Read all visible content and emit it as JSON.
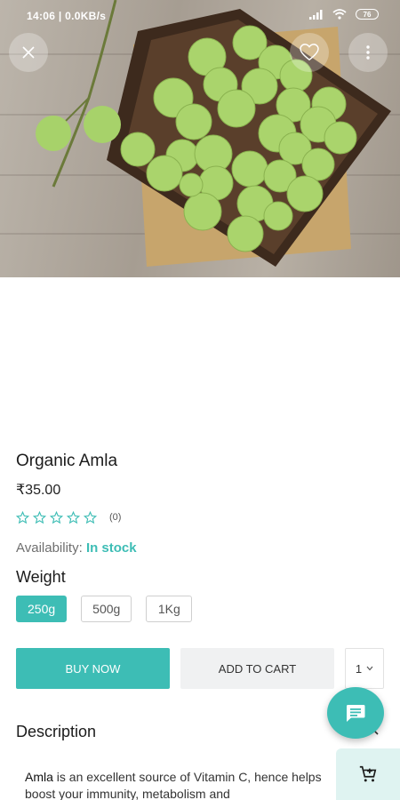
{
  "status_bar": {
    "time": "14:06 | 0.0KB/s",
    "battery": "76"
  },
  "product": {
    "name": "Organic Amla",
    "price": "₹35.00",
    "rating_value": 0,
    "review_count": "(0)",
    "availability_label": "Availability:",
    "availability_value": "In stock"
  },
  "weight": {
    "title": "Weight",
    "options": [
      "250g",
      "500g",
      "1Kg"
    ],
    "selected": "250g"
  },
  "actions": {
    "buy_now": "BUY NOW",
    "add_to_cart": "ADD TO CART",
    "quantity": "1"
  },
  "description": {
    "title": "Description",
    "highlight": "Amla",
    "text_rest": " is an excellent source of Vitamin C, hence helps boost your immunity, metabolism and"
  },
  "icons": {
    "close": "close-icon",
    "favorite": "heart-outline-icon",
    "more": "more-vertical-icon",
    "chat": "chat-icon",
    "cart": "cart-add-icon"
  },
  "colors": {
    "accent": "#3dbdb5",
    "secondary_button": "#f0f1f2",
    "cart_fab_bg": "#dff3f1"
  }
}
